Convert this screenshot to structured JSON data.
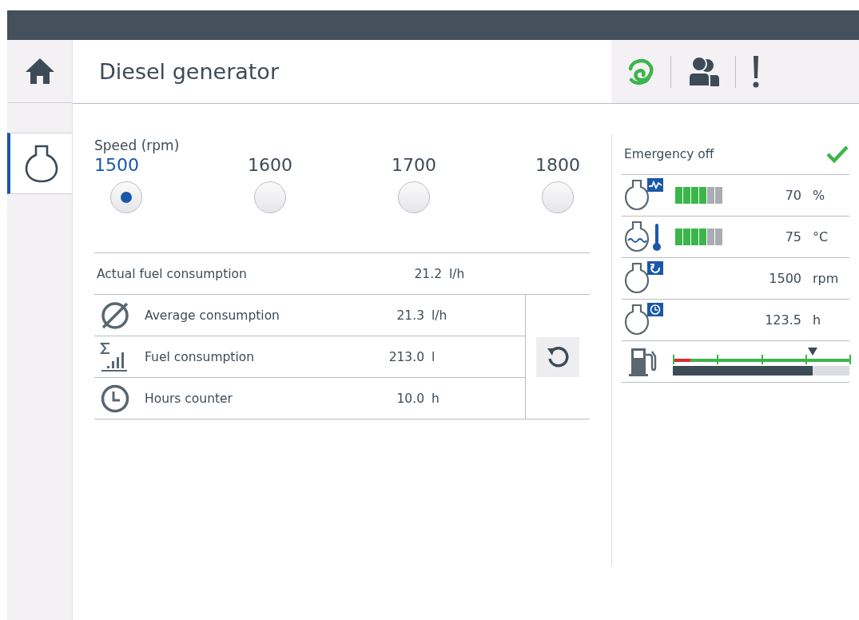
{
  "header": {
    "title": "Diesel generator"
  },
  "sidebar": {
    "items": [
      {
        "kind": "home",
        "selected": false
      },
      {
        "kind": "engine",
        "selected": true
      }
    ]
  },
  "speed": {
    "label": "Speed (rpm)",
    "options": [
      {
        "value": "1500",
        "selected": true
      },
      {
        "value": "1600",
        "selected": false
      },
      {
        "value": "1700",
        "selected": false
      },
      {
        "value": "1800",
        "selected": false
      }
    ]
  },
  "actual": {
    "label": "Actual fuel consumption",
    "value": "21.2",
    "unit": "l/h"
  },
  "counters": [
    {
      "kind": "average",
      "label": "Average consumption",
      "value": "21.3",
      "unit": "l/h"
    },
    {
      "kind": "sum",
      "label": "Fuel consumption",
      "value": "213.0",
      "unit": "l"
    },
    {
      "kind": "clock",
      "label": "Hours counter",
      "value": "10.0",
      "unit": "h"
    }
  ],
  "status": {
    "label": "Emergency off",
    "ok": true
  },
  "readings": [
    {
      "kind": "load",
      "level": 0.7,
      "value": "70",
      "unit": "%"
    },
    {
      "kind": "temperature",
      "level": 0.7,
      "value": "75",
      "unit": "°C"
    },
    {
      "kind": "speed",
      "value": "1500",
      "unit": "rpm"
    },
    {
      "kind": "hours",
      "value": "123.5",
      "unit": "h"
    }
  ],
  "fuel": {
    "level": 0.79
  }
}
